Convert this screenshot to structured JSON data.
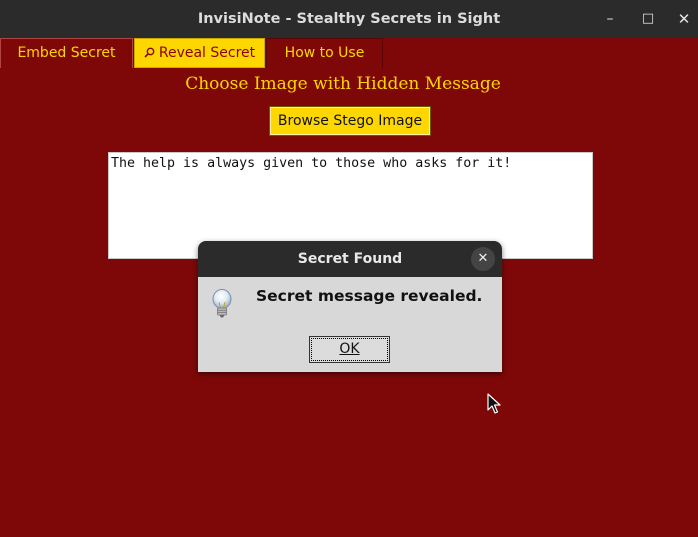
{
  "window": {
    "title": "InvisiNote - Stealthy Secrets in Sight",
    "controls": {
      "minimize": "–",
      "maximize": "□",
      "close": "✕"
    }
  },
  "tabs": [
    {
      "label": "Embed Secret",
      "active": false
    },
    {
      "label": "Reveal Secret",
      "icon": "magnifier-icon",
      "active": true
    },
    {
      "label": "How to Use",
      "active": false
    }
  ],
  "reveal": {
    "heading": "Choose Image with Hidden Message",
    "browse_label": "Browse Stego Image",
    "message_text": "The help is always given to those who asks for it!"
  },
  "dialog": {
    "title": "Secret Found",
    "message": "Secret message revealed.",
    "icon": "lightbulb-icon",
    "ok_label": "OK"
  },
  "colors": {
    "background": "#7e0808",
    "accent": "#ffd700",
    "titlebar": "#2b2b2b",
    "dialog_bg": "#d8d8d8"
  }
}
